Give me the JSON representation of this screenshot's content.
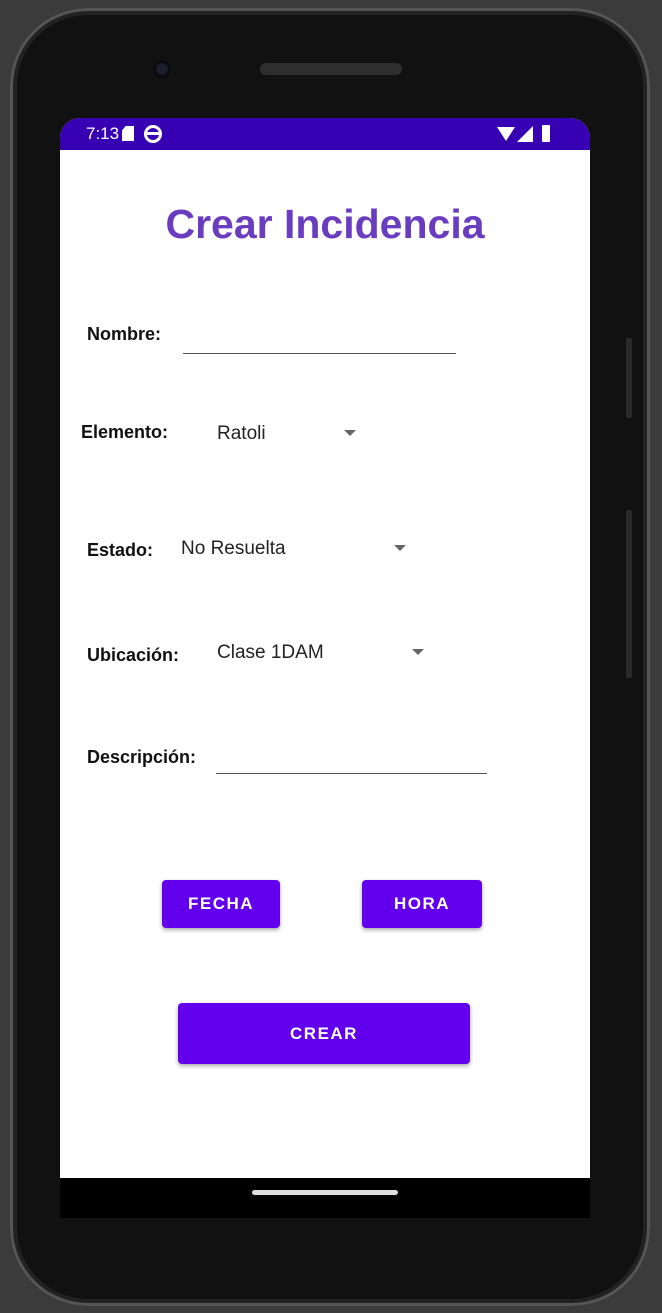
{
  "status_bar": {
    "time": "7:13"
  },
  "title": "Crear Incidencia",
  "form": {
    "nombre": {
      "label": "Nombre:",
      "value": ""
    },
    "elemento": {
      "label": "Elemento:",
      "selected": "Ratoli"
    },
    "estado": {
      "label": "Estado:",
      "selected": "No Resuelta"
    },
    "ubicacion": {
      "label": "Ubicación:",
      "selected": "Clase 1DAM"
    },
    "descripcion": {
      "label": "Descripción:",
      "value": ""
    }
  },
  "buttons": {
    "fecha": "FECHA",
    "hora": "HORA",
    "crear": "CREAR"
  },
  "colors": {
    "status_bar": "#3700b3",
    "title": "#6a3dc0",
    "button": "#6200ee"
  },
  "icons": [
    "sd-card-icon",
    "settings-icon",
    "wifi-icon",
    "signal-icon",
    "battery-icon"
  ]
}
